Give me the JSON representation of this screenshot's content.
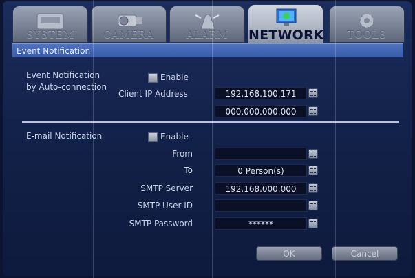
{
  "tabs": [
    {
      "label": "SYSTEM",
      "icon": "system-icon",
      "active": false
    },
    {
      "label": "CAMERA",
      "icon": "camera-icon",
      "active": false
    },
    {
      "label": "ALARM",
      "icon": "alarm-icon",
      "active": false
    },
    {
      "label": "NETWORK",
      "icon": "network-icon",
      "active": true
    },
    {
      "label": "TOOLS",
      "icon": "tools-icon",
      "active": false
    }
  ],
  "header": {
    "title": "Event Notification"
  },
  "event_section": {
    "label_line1": "Event Notification",
    "label_line2": "by Auto-connection",
    "enable_label": "Enable",
    "client_ip_label": "Client IP Address",
    "client_ip_1": "192.168.100.171",
    "client_ip_2": "000.000.000.000"
  },
  "email_section": {
    "label": "E-mail Notification",
    "enable_label": "Enable",
    "from_label": "From",
    "from_value": "",
    "to_label": "To",
    "to_value": "0 Person(s)",
    "smtp_server_label": "SMTP Server",
    "smtp_server_value": "192.168.000.000",
    "smtp_user_label": "SMTP User ID",
    "smtp_user_value": "",
    "smtp_password_label": "SMTP Password",
    "smtp_password_value": "******"
  },
  "buttons": {
    "ok": "OK",
    "cancel": "Cancel"
  },
  "colors": {
    "header_bar": "#4a6bbd",
    "background": "#13224a",
    "field": "#0a1026"
  }
}
